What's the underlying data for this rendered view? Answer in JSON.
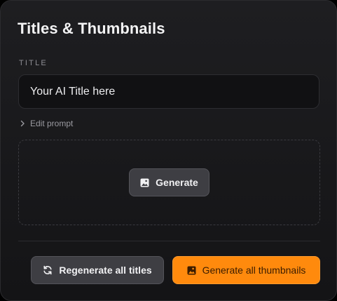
{
  "panel": {
    "heading": "Titles & Thumbnails"
  },
  "title_field": {
    "label": "TITLE",
    "value": "Your AI Title here",
    "placeholder": ""
  },
  "edit_prompt": {
    "label": "Edit prompt",
    "icon": "chevron-right-icon"
  },
  "thumbnail_area": {
    "generate_label": "Generate",
    "generate_icon": "image-icon"
  },
  "footer": {
    "regenerate_label": "Regenerate all titles",
    "regenerate_icon": "refresh-icon",
    "generate_thumbnails_label": "Generate all thumbnails",
    "generate_thumbnails_icon": "image-icon"
  },
  "colors": {
    "background": "#161618",
    "accent": "#ff8a0d",
    "secondary_button": "#3e3e43"
  }
}
